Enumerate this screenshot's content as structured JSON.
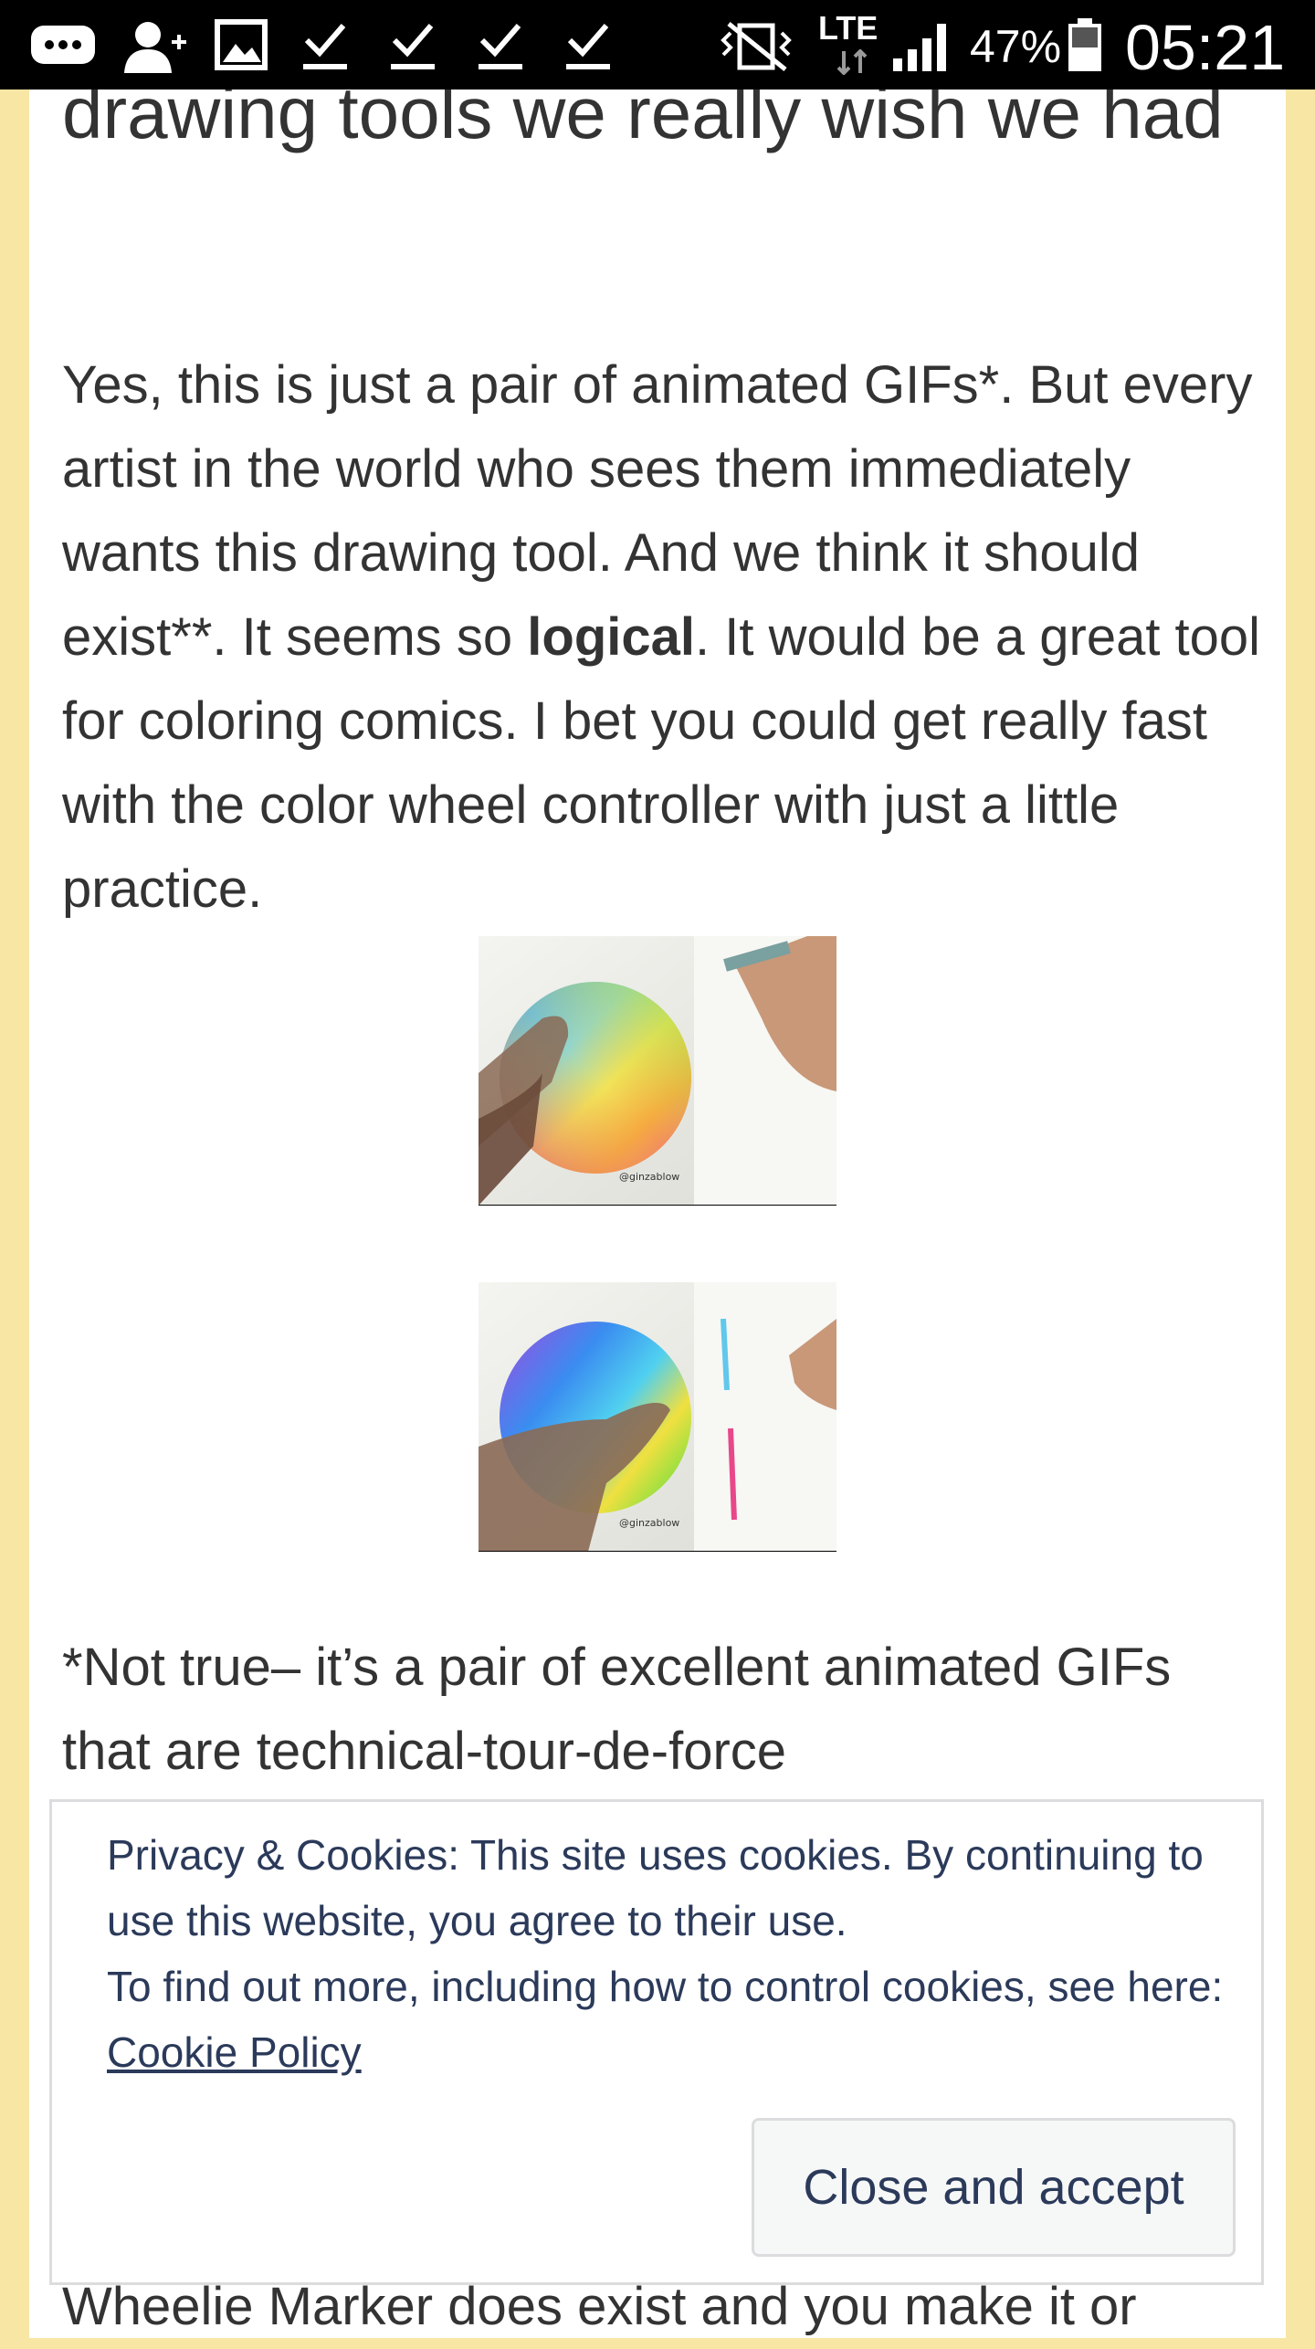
{
  "status_bar": {
    "battery": "47%",
    "time": "05:21",
    "network": "LTE",
    "icons": [
      "chat-bubble-icon",
      "add-contact-icon",
      "image-icon",
      "download-done-icon",
      "download-done-icon",
      "download-done-icon",
      "download-done-icon",
      "vibrate-mute-icon",
      "lte-icon",
      "signal-icon",
      "battery-icon"
    ]
  },
  "article": {
    "title_partial": "drawing tools we really wish we had",
    "paragraph1_before_bold": "Yes,  this is just a pair of animated GIFs*. But every artist in the world who sees them immediately wants this drawing tool.  And we think it should exist**.  It seems so ",
    "paragraph1_bold": "logical",
    "paragraph1_after_bold": ".  It would be a great tool for coloring comics.  I bet you could get really fast with the color wheel controller with just a little practice.",
    "gif1_watermark": "@ginzablow",
    "gif2_watermark": "@ginzablow",
    "paragraph2": "*Not true– it’s a pair of excellent animated GIFs that are technical-tour-de-force",
    "paragraph3_partial": "Wheelie Marker does exist and you make it or"
  },
  "cookie_banner": {
    "line1": "Privacy & Cookies: This site uses cookies. By continuing to use this website, you agree to their use.",
    "line2_prefix": "To find out more, including how to control cookies, see here: ",
    "policy_link": "Cookie Policy",
    "close_button": "Close and accept"
  },
  "colors": {
    "page_background": "#f7e6a4",
    "card_background": "#ffffff",
    "text": "#333333",
    "cookie_text": "#2b3a5a",
    "cookie_border": "#dcdcde"
  }
}
